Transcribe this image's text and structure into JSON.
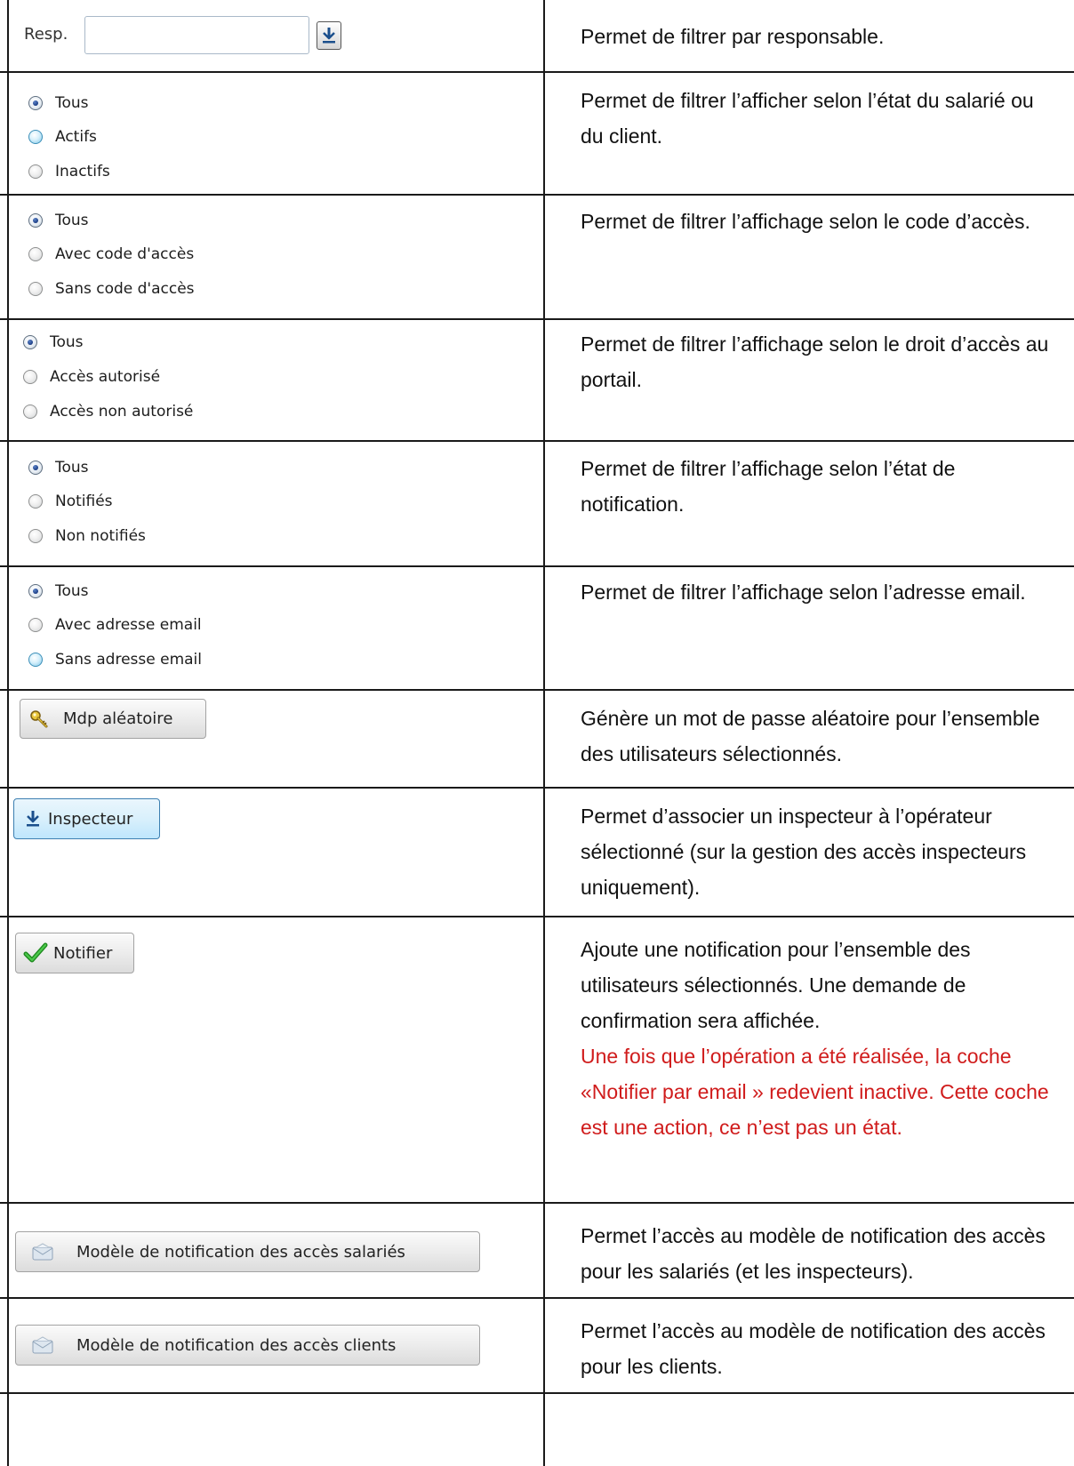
{
  "rows": [
    {
      "resp_label": "Resp.",
      "resp_value": "",
      "description": "Permet de filtrer par responsable."
    },
    {
      "options": [
        "Tous",
        "Actifs",
        "Inactifs"
      ],
      "description": "Permet de filtrer l’afficher selon l’état du salarié ou du client."
    },
    {
      "options": [
        "Tous",
        "Avec code d'accès",
        "Sans code d'accès"
      ],
      "description": "Permet de filtrer l’affichage selon le code d’accès."
    },
    {
      "options": [
        "Tous",
        "Accès autorisé",
        "Accès non autorisé"
      ],
      "description": "Permet de filtrer l’affichage selon le droit d’accès au portail."
    },
    {
      "options": [
        "Tous",
        "Notifiés",
        "Non notifiés"
      ],
      "description": "Permet de filtrer l’affichage selon l’état de notification."
    },
    {
      "options": [
        "Tous",
        "Avec adresse email",
        "Sans adresse email"
      ],
      "description": "Permet de filtrer l’affichage selon l’adresse email."
    },
    {
      "button_label": "Mdp aléatoire",
      "description": "Génère un mot de passe aléatoire pour l’ensemble des utilisateurs sélectionnés."
    },
    {
      "button_label": "Inspecteur",
      "description": "Permet d’associer un inspecteur à l’opérateur sélectionné (sur la gestion des accès inspecteurs uniquement)."
    },
    {
      "button_label": "Notifier",
      "description": "Ajoute une notification pour l’ensemble des utilisateurs sélectionnés. Une demande de confirmation sera affichée.",
      "warning": "Une fois que l’opération a été réalisée, la coche «Notifier par email » redevient inactive. Cette coche est une action, ce n’est pas un état."
    },
    {
      "button_label": "Modèle de notification des accès salariés",
      "description": "Permet l’accès au modèle de notification des accès pour les salariés (et les inspecteurs)."
    },
    {
      "button_label": "Modèle de notification des accès clients",
      "description": "Permet l’accès au modèle de notification des accès pour les clients."
    }
  ],
  "colors": {
    "border": "#1a1a1a",
    "warning_text": "#d01c1c",
    "radio_checked": "#1d3f86",
    "radio_hover": "#7cc6e8"
  },
  "icons": {
    "resp_dropdown": "arrow-down-icon",
    "mdp": "key-icon",
    "inspecteur": "arrow-down-icon",
    "notifier": "checkmark-icon",
    "modele": "envelope-icon"
  }
}
